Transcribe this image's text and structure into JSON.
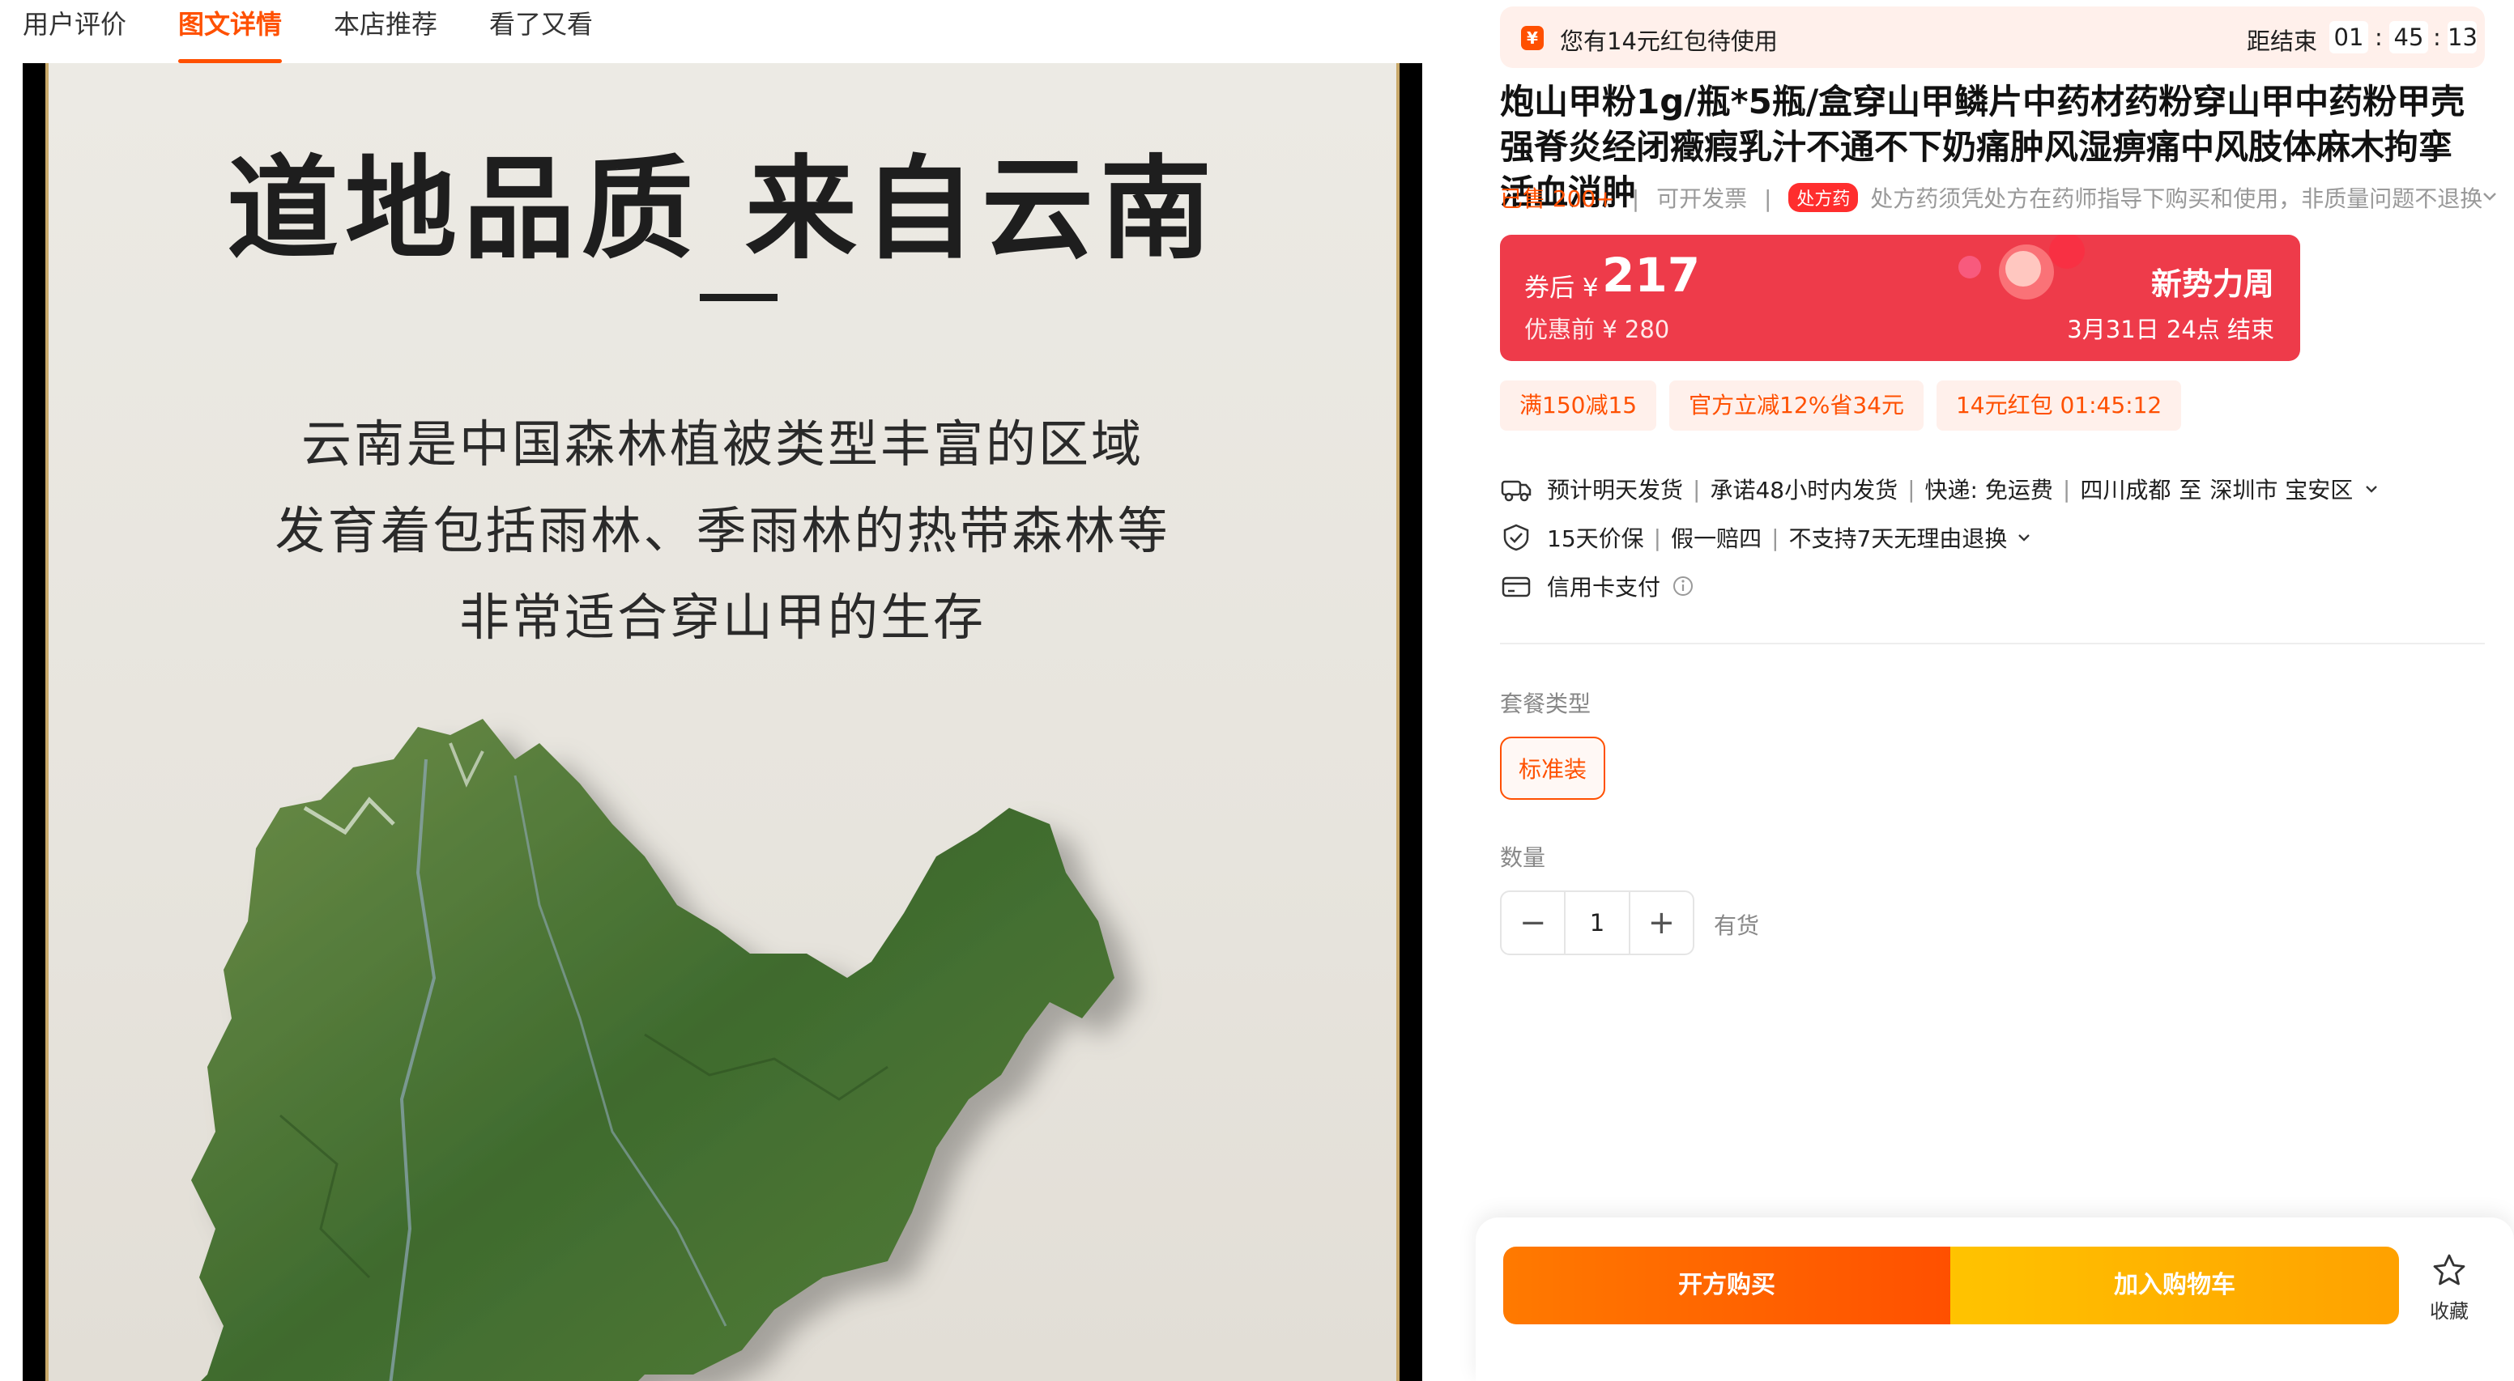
{
  "tabs": [
    {
      "label": "用户评价",
      "active": false
    },
    {
      "label": "图文详情",
      "active": true
    },
    {
      "label": "本店推荐",
      "active": false
    },
    {
      "label": "看了又看",
      "active": false
    }
  ],
  "poster": {
    "headline": "道地品质 来自云南",
    "lines": [
      "云南是中国森林植被类型丰富的区域",
      "发育着包括雨林、季雨林的热带森林等",
      "非常适合穿山甲的生存"
    ]
  },
  "redpack": {
    "icon": "¥",
    "text": "您有14元红包待使用",
    "end_label": "距结束",
    "timer": {
      "h": "01",
      "m": "45",
      "s": "13"
    }
  },
  "product": {
    "title": "炮山甲粉1g/瓶*5瓶/盒穿山甲鳞片中药材药粉穿山甲中药粉甲壳强脊炎经闭癥瘕乳汁不通不下奶痛肿风湿痹痛中风肢体麻木拘挛活血消肿",
    "sold": "已售 200+",
    "invoice": "可开发票",
    "rx_badge": "处方药",
    "rx_notice": "处方药须凭处方在药师指导下购买和使用，非质量问题不退换"
  },
  "price": {
    "label": "券后",
    "currency": "¥",
    "value": "217",
    "original": "优惠前 ¥ 280",
    "promo": "新势力周",
    "end": "3月31日 24点 结束"
  },
  "coupons": [
    "满150减15",
    "官方立减12%省34元",
    "14元红包 01:45:12"
  ],
  "shipping": {
    "icon": "truck-icon",
    "text": "预计明天发货",
    "promise": "承诺48小时内发货",
    "express": "快递: 免运费",
    "from": "四川成都",
    "to_word": "至",
    "to": "深圳市 宝安区"
  },
  "guarantee": {
    "icon": "shield-icon",
    "items": [
      "15天价保",
      "假一赔四",
      "不支持7天无理由退换"
    ]
  },
  "payment": {
    "icon": "card-icon",
    "text": "信用卡支付"
  },
  "package": {
    "label": "套餐类型",
    "selected": "标准装"
  },
  "quantity": {
    "label": "数量",
    "minus": "−",
    "value": "1",
    "plus": "+",
    "stock": "有货"
  },
  "actions": {
    "buy": "开方购买",
    "cart": "加入购物车",
    "fav": "收藏"
  },
  "colors": {
    "accent": "#ff5000",
    "price_bg": "#ee3b4a",
    "cart": "#ffa100"
  }
}
